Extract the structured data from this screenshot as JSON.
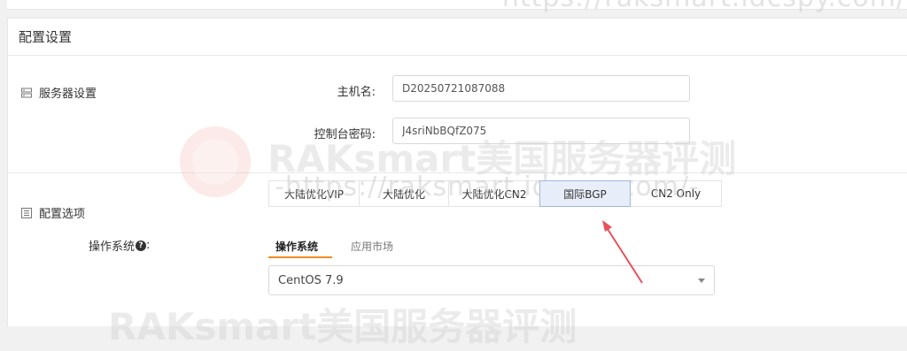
{
  "panel": {
    "title": "配置设置"
  },
  "server_settings": {
    "label": "服务器设置",
    "hostname_label": "主机名:",
    "hostname_value": "D20250721087088",
    "password_label": "控制台密码:",
    "password_value": "J4sriNbBQfZ075"
  },
  "config_options": {
    "label": "配置选项",
    "tabs": [
      {
        "label": "大陆优化VIP"
      },
      {
        "label": "大陆优化"
      },
      {
        "label": "大陆优化CN2"
      },
      {
        "label": "国际BGP"
      },
      {
        "label": "CN2 Only"
      }
    ],
    "selected_tab": "国际BGP"
  },
  "os": {
    "label": "操作系统",
    "subtabs": [
      {
        "label": "操作系统"
      },
      {
        "label": "应用市场"
      }
    ],
    "selected_value": "CentOS 7.9"
  },
  "watermark": {
    "brand": "RAKsmart美国服务器评测",
    "url": "-https://raksmart.idcspy.com/-"
  },
  "colors": {
    "accent_underline": "#f08a24",
    "selected_tab_bg": "#e8eef9",
    "arrow": "#e8505b"
  }
}
